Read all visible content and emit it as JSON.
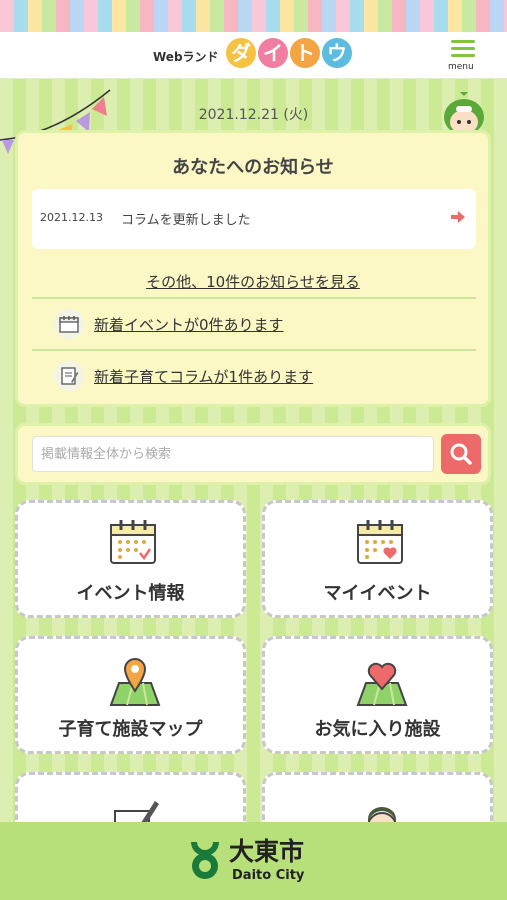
{
  "header": {
    "logo_prefix": "Webランド",
    "logo_chars": [
      "ダ",
      "イ",
      "ト",
      "ウ"
    ],
    "logo_colors": [
      "#f5c242",
      "#f07ea1",
      "#f2a542",
      "#5bbbe0"
    ],
    "menu_label": "menu"
  },
  "date": "2021.12.21 (火)",
  "notice": {
    "title": "あなたへのお知らせ",
    "items": [
      {
        "date": "2021.12.13",
        "text": "コラムを更新しました"
      }
    ],
    "more_link": "その他、10件のお知らせを見る",
    "events_link": "新着イベントが0件あります",
    "columns_link": "新着子育てコラムが1件あります"
  },
  "search": {
    "placeholder": "掲載情報全体から検索"
  },
  "tiles": [
    {
      "label": "イベント情報"
    },
    {
      "label": "マイイベント"
    },
    {
      "label": "子育て施設マップ"
    },
    {
      "label": "お気に入り施設"
    }
  ],
  "footer": {
    "title": "大東市",
    "subtitle": "Daito City"
  },
  "colors": {
    "accent_green": "#84c33e",
    "search_red": "#ee6a6a",
    "arrow_red": "#ee6a6a"
  }
}
